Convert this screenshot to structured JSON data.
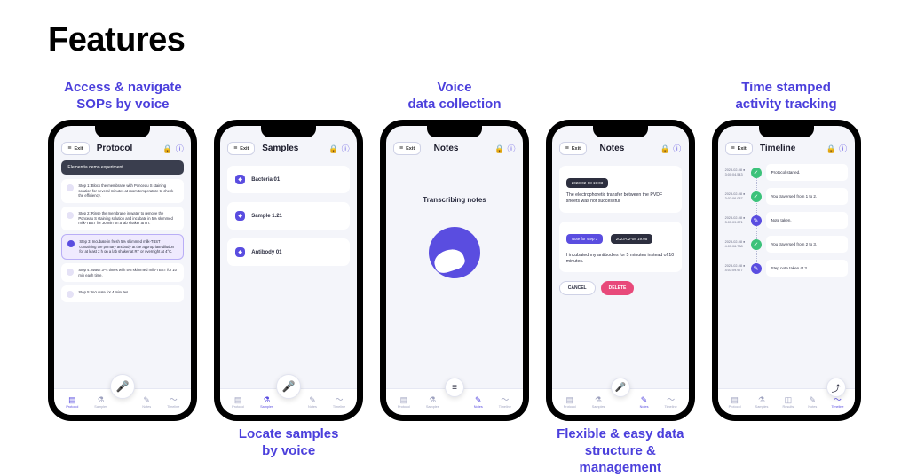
{
  "headline": "Features",
  "accent": "#4b3fdc",
  "captions": {
    "sops": "Access & navigate\nSOPs by voice",
    "voice": "Voice\ndata collection",
    "timeline": "Time stamped\nactivity tracking",
    "samples": "Locate samples\nby voice",
    "notes": "Flexible & easy data\nstructure & management"
  },
  "phone1": {
    "exit": "Exit",
    "title": "Protocol",
    "banner": "Elementia demo experiment",
    "steps": [
      "Step 1: Block the membrane with Ponceau S staining solution for several minutes at room temperature to check the efficiency.",
      "Step 2: Rinse the membrane in water to remove the Ponceau S staining solution and incubate in 5% skimmed milk-TBST for 30 min on a lab shaker at RT.",
      "Step 3: Incubate in fresh 5% skimmed milk-TBST containing the primary antibody at the appropriate dilution for at least 2 h on a lab shaker at RT or overnight at 4°C.",
      "Step 4: Wash 3–4 times with 5% skimmed milk-TBST for 10 min each time.",
      "Step 5: Incubate for 4 minutes."
    ],
    "activeStep": 2
  },
  "phone2": {
    "exit": "Exit",
    "title": "Samples",
    "items": [
      "Bacteria 01",
      "Sample 1.21",
      "Antibody 01"
    ]
  },
  "phone3": {
    "exit": "Exit",
    "title": "Notes",
    "transcribing": "Transcribing notes"
  },
  "phone4": {
    "exit": "Exit",
    "title": "Notes",
    "note1": {
      "date": "2023-02-08 19:03",
      "text": "The electrophoretic transfer between the PVDF sheets was not successful."
    },
    "note2": {
      "tag": "Note for step 3",
      "date": "2023-02-08 19:05",
      "text": "I incubated my antibodies for 5 minutes instead of 10 minutes."
    },
    "cancel": "CANCEL",
    "delete": "DELETE"
  },
  "phone5": {
    "exit": "Exit",
    "title": "Timeline",
    "events": [
      {
        "ts": "2023-02-08 ● 3:00:04.543",
        "kind": "green",
        "text": "Protocol started."
      },
      {
        "ts": "2023-02-08 ● 3:03:06.087",
        "kind": "green",
        "text": "You traversed from 1 to 2."
      },
      {
        "ts": "2023-02-08 ● 3:03:09.071",
        "kind": "purple",
        "text": "Note taken."
      },
      {
        "ts": "2023-02-08 ● 4:03:06.788",
        "kind": "green",
        "text": "You traversed from 2 to 3."
      },
      {
        "ts": "2023-02-08 ● 4:03:09.977",
        "kind": "purple",
        "text": "Step note taken at 3."
      }
    ]
  },
  "tabs": {
    "protocol": "Protocol",
    "samples": "Samples",
    "results": "Results",
    "notes": "Notes",
    "timeline": "Timeline"
  }
}
